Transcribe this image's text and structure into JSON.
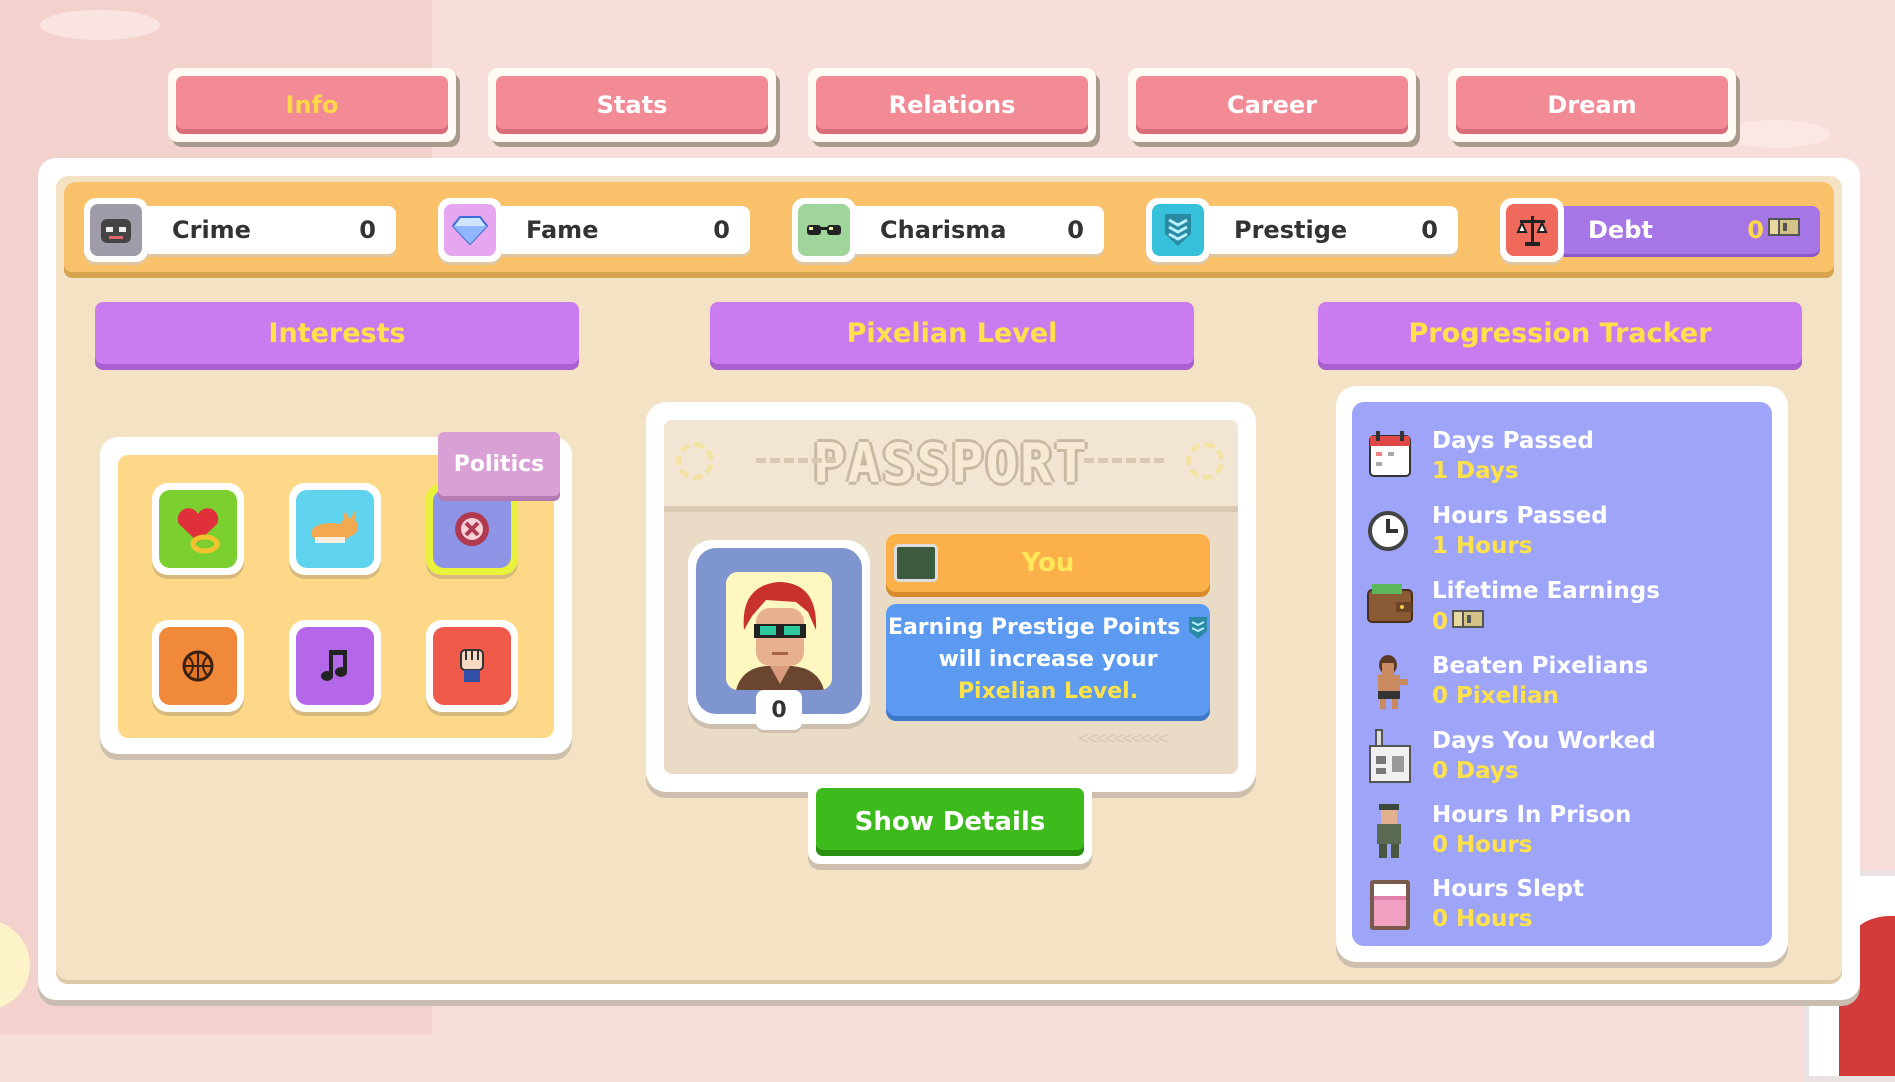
{
  "tabs": [
    {
      "label": "Info",
      "active": true
    },
    {
      "label": "Stats",
      "active": false
    },
    {
      "label": "Relations",
      "active": false
    },
    {
      "label": "Career",
      "active": false
    },
    {
      "label": "Dream",
      "active": false
    }
  ],
  "stats": [
    {
      "label": "Crime",
      "value": "0",
      "icon": "mask-icon",
      "color": "#a09ba8"
    },
    {
      "label": "Fame",
      "value": "0",
      "icon": "diamond-icon",
      "color": "#e7a6f0"
    },
    {
      "label": "Charisma",
      "value": "0",
      "icon": "sunglasses-icon",
      "color": "#9fd59a"
    },
    {
      "label": "Prestige",
      "value": "0",
      "icon": "shield-icon",
      "color": "#36c0d9"
    },
    {
      "label": "Debt",
      "value": "0",
      "icon": "scales-icon",
      "color": "#ef6a5d"
    }
  ],
  "sections": {
    "interests": "Interests",
    "pixelian_level": "Pixelian Level",
    "progression": "Progression Tracker"
  },
  "interests": {
    "tooltip": "Politics",
    "items": [
      {
        "icon": "love-ring-icon",
        "color": "#7bcf2e"
      },
      {
        "icon": "cat-icon",
        "color": "#60d3ef"
      },
      {
        "icon": "politics-badge-icon",
        "color": "#8e95e6"
      },
      {
        "icon": "basketball-icon",
        "color": "#f08a3a"
      },
      {
        "icon": "music-note-icon",
        "color": "#b467e8"
      },
      {
        "icon": "fist-icon",
        "color": "#ef5a4a"
      }
    ]
  },
  "passport": {
    "title": "PASSPORT",
    "name": "You",
    "level": "0",
    "desc_part1": "Earning Prestige Points",
    "desc_part2": "will increase your",
    "desc_highlight": "Pixelian Level.",
    "arrows": "<<<<<<<<<<",
    "button": "Show Details"
  },
  "progression": [
    {
      "label": "Days Passed",
      "value": "1 Days",
      "icon": "calendar-icon"
    },
    {
      "label": "Hours Passed",
      "value": "1 Hours",
      "icon": "clock-icon"
    },
    {
      "label": "Lifetime Earnings",
      "value": "0",
      "icon": "wallet-icon",
      "currency": true
    },
    {
      "label": "Beaten Pixelians",
      "value": "0 Pixelian",
      "icon": "fighter-icon"
    },
    {
      "label": "Days You Worked",
      "value": "0 Days",
      "icon": "factory-icon"
    },
    {
      "label": "Hours In Prison",
      "value": "0 Hours",
      "icon": "prisoner-icon"
    },
    {
      "label": "Hours Slept",
      "value": "0 Hours",
      "icon": "bed-icon"
    }
  ]
}
